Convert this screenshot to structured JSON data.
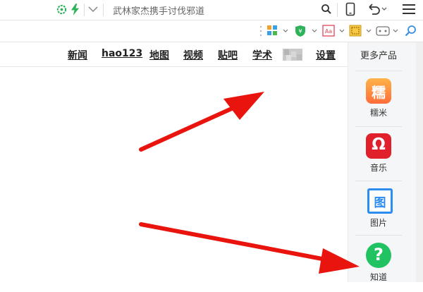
{
  "address_bar": {
    "url_text": "武林家杰携手讨伐邪道"
  },
  "nav": {
    "links": [
      "新闻",
      "hao123",
      "地图",
      "视频",
      "贴吧",
      "学术",
      "设置"
    ]
  },
  "sidebar": {
    "heading": "更多产品",
    "items": [
      {
        "label": "糯米",
        "icon_glyph": "糯",
        "color": "#ff6d3a",
        "icon": "nuomi-icon"
      },
      {
        "label": "音乐",
        "icon_glyph": "Ω",
        "color": "#e0202a",
        "icon": "music-icon"
      },
      {
        "label": "图片",
        "icon_glyph": "图",
        "color": "#2d8cf0",
        "icon": "image-icon"
      },
      {
        "label": "知道",
        "icon_glyph": "?",
        "color": "#21c262",
        "icon": "zhidao-icon"
      }
    ]
  },
  "colors": {
    "arrow": "#e8140d",
    "accent_green": "#2fb35a"
  }
}
